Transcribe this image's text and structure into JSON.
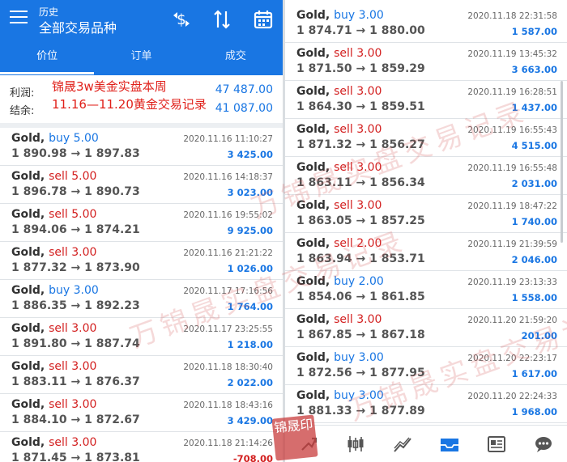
{
  "header": {
    "subtitle": "历史",
    "title": "全部交易品种",
    "tabs": [
      {
        "label": "价位",
        "active": true
      },
      {
        "label": "订单",
        "active": false
      },
      {
        "label": "成交",
        "active": false
      }
    ]
  },
  "summary": {
    "profit_label": "利润:",
    "profit_value": "47 487.00",
    "balance_label": "结余:",
    "balance_value": "41 087.00",
    "promo_line1": "锦晟3w美金实盘本周",
    "promo_line2": "11.16—11.20黄金交易记录"
  },
  "trades_left": [
    {
      "symbol": "Gold,",
      "side": "buy 5.00",
      "type": "buy",
      "prices": "1 890.98 → 1 897.83",
      "time": "2020.11.16 11:10:27",
      "profit": "3 425.00"
    },
    {
      "symbol": "Gold,",
      "side": "sell 5.00",
      "type": "sell",
      "prices": "1 896.78 → 1 890.73",
      "time": "2020.11.16 14:18:37",
      "profit": "3 023.00"
    },
    {
      "symbol": "Gold,",
      "side": "sell 5.00",
      "type": "sell",
      "prices": "1 894.06 → 1 874.21",
      "time": "2020.11.16 19:55:02",
      "profit": "9 925.00"
    },
    {
      "symbol": "Gold,",
      "side": "sell 3.00",
      "type": "sell",
      "prices": "1 877.32 → 1 873.90",
      "time": "2020.11.16 21:21:22",
      "profit": "1 026.00"
    },
    {
      "symbol": "Gold,",
      "side": "buy 3.00",
      "type": "buy",
      "prices": "1 886.35 → 1 892.23",
      "time": "2020.11.17 17:16:56",
      "profit": "1 764.00"
    },
    {
      "symbol": "Gold,",
      "side": "sell 3.00",
      "type": "sell",
      "prices": "1 891.80 → 1 887.74",
      "time": "2020.11.17 23:25:55",
      "profit": "1 218.00"
    },
    {
      "symbol": "Gold,",
      "side": "sell 3.00",
      "type": "sell",
      "prices": "1 883.11 → 1 876.37",
      "time": "2020.11.18 18:30:40",
      "profit": "2 022.00"
    },
    {
      "symbol": "Gold,",
      "side": "sell 3.00",
      "type": "sell",
      "prices": "1 884.10 → 1 872.67",
      "time": "2020.11.18 18:43:16",
      "profit": "3 429.00"
    },
    {
      "symbol": "Gold,",
      "side": "sell 3.00",
      "type": "sell",
      "prices": "1 871.45 → 1 873.81",
      "time": "2020.11.18 21:14:26",
      "profit": "-708.00"
    }
  ],
  "trades_right": [
    {
      "symbol": "Gold,",
      "side": "buy 3.00",
      "type": "buy",
      "prices": "1 874.71 → 1 880.00",
      "time": "2020.11.18 22:31:58",
      "profit": "1 587.00"
    },
    {
      "symbol": "Gold,",
      "side": "sell 3.00",
      "type": "sell",
      "prices": "1 871.50 → 1 859.29",
      "time": "2020.11.19 13:45:32",
      "profit": "3 663.00"
    },
    {
      "symbol": "Gold,",
      "side": "sell 3.00",
      "type": "sell",
      "prices": "1 864.30 → 1 859.51",
      "time": "2020.11.19 16:28:51",
      "profit": "1 437.00"
    },
    {
      "symbol": "Gold,",
      "side": "sell 3.00",
      "type": "sell",
      "prices": "1 871.32 → 1 856.27",
      "time": "2020.11.19 16:55:43",
      "profit": "4 515.00"
    },
    {
      "symbol": "Gold,",
      "side": "sell 3.00",
      "type": "sell",
      "prices": "1 863.11 → 1 856.34",
      "time": "2020.11.19 16:55:48",
      "profit": "2 031.00"
    },
    {
      "symbol": "Gold,",
      "side": "sell 3.00",
      "type": "sell",
      "prices": "1 863.05 → 1 857.25",
      "time": "2020.11.19 18:47:22",
      "profit": "1 740.00"
    },
    {
      "symbol": "Gold,",
      "side": "sell 2.00",
      "type": "sell",
      "prices": "1 863.94 → 1 853.71",
      "time": "2020.11.19 21:39:59",
      "profit": "2 046.00"
    },
    {
      "symbol": "Gold,",
      "side": "buy 2.00",
      "type": "buy",
      "prices": "1 854.06 → 1 861.85",
      "time": "2020.11.19 23:13:33",
      "profit": "1 558.00"
    },
    {
      "symbol": "Gold,",
      "side": "sell 3.00",
      "type": "sell",
      "prices": "1 867.85 → 1 867.18",
      "time": "2020.11.20 21:59:20",
      "profit": "201.00"
    },
    {
      "symbol": "Gold,",
      "side": "buy 3.00",
      "type": "buy",
      "prices": "1 872.56 → 1 877.95",
      "time": "2020.11.20 22:23:17",
      "profit": "1 617.00"
    },
    {
      "symbol": "Gold,",
      "side": "buy 3.00",
      "type": "buy",
      "prices": "1 881.33 → 1 877.89",
      "time": "2020.11.20 22:24:33",
      "profit": "1 968.00"
    }
  ],
  "bottom_nav": [
    {
      "icon": "trade-icon",
      "active": false
    },
    {
      "icon": "chart-icon",
      "active": false
    },
    {
      "icon": "trend-icon",
      "active": false
    },
    {
      "icon": "history-icon",
      "active": true
    },
    {
      "icon": "news-icon",
      "active": false
    },
    {
      "icon": "chat-icon",
      "active": false
    }
  ],
  "watermark": "万锦晟实盘交易记录",
  "seal_text": "锦晟印"
}
